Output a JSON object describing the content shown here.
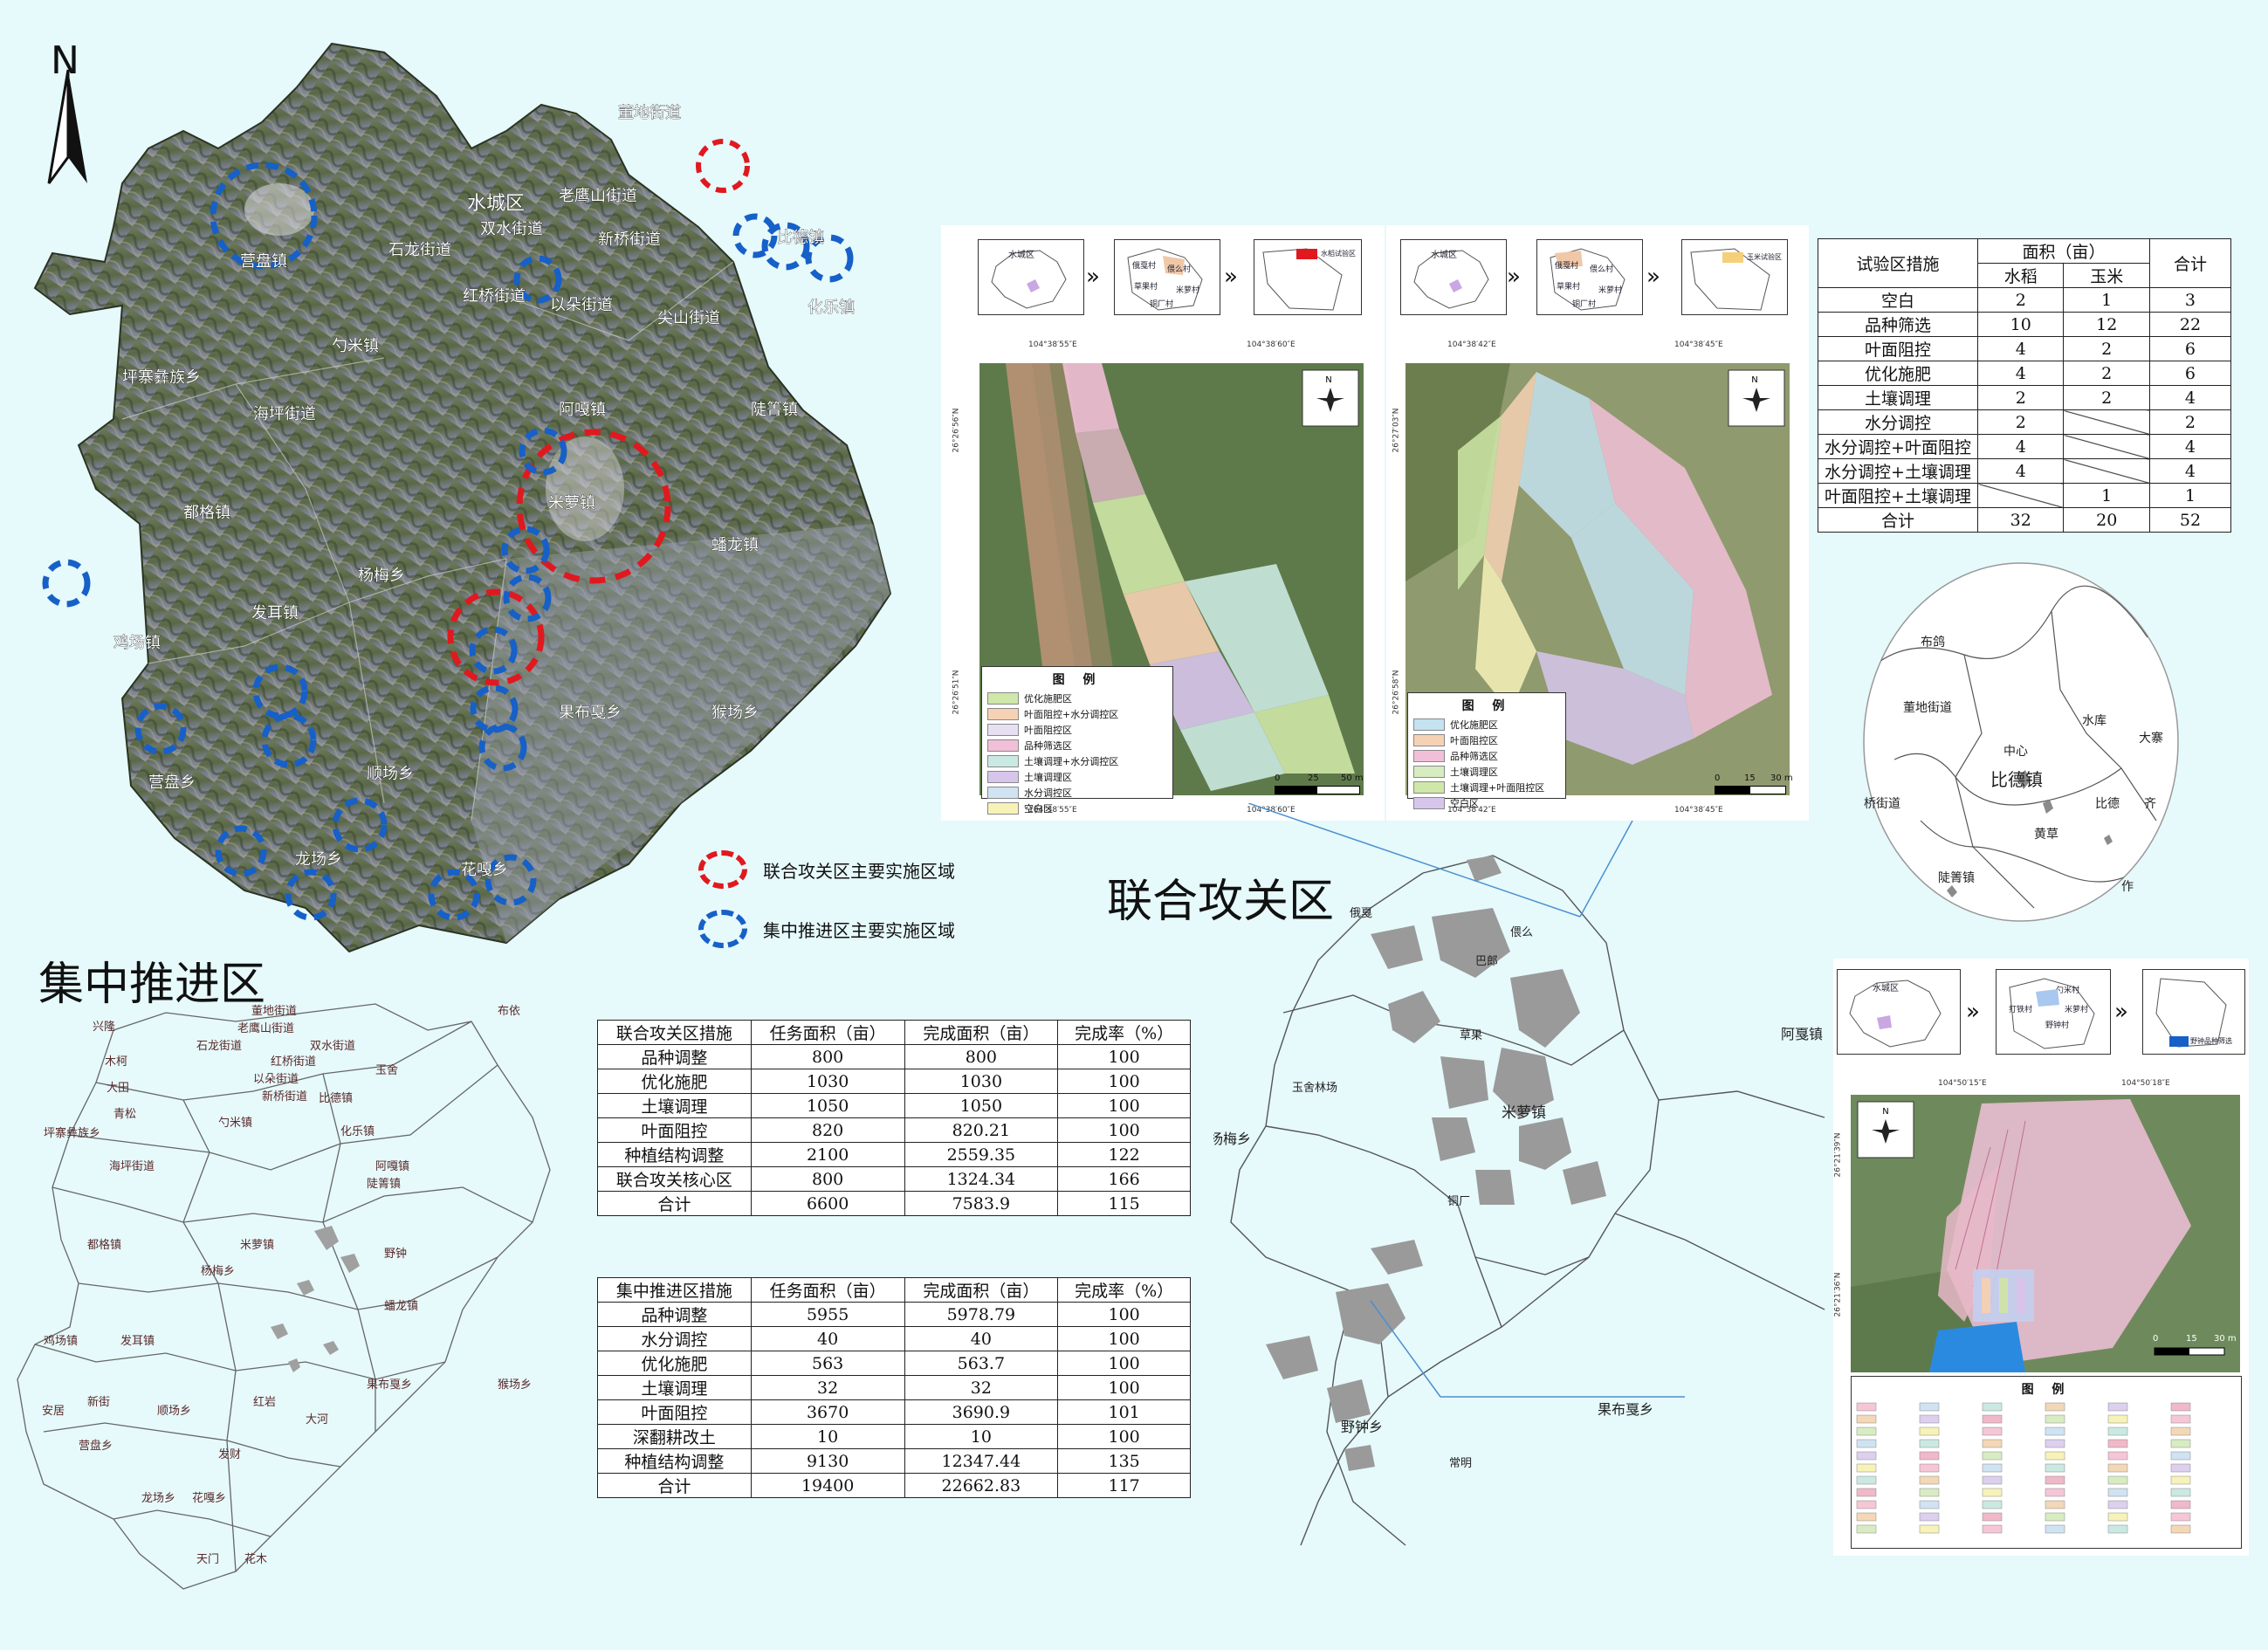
{
  "north": "N",
  "titles": {
    "joint": "联合攻关区",
    "central": "集中推进区"
  },
  "legend": {
    "joint_area": "联合攻关区主要实施区域",
    "central_area": "集中推进区主要实施区域",
    "joint_color": "#e0191f",
    "central_color": "#1660c8"
  },
  "satellite_labels": [
    "水城区",
    "董地街道",
    "老鹰山街道",
    "双水街道",
    "石龙街道",
    "红桥街道",
    "以朵街道",
    "新桥街道",
    "比德镇",
    "化乐镇",
    "营盘镇",
    "勺米镇",
    "尖山街道",
    "坪寨彝族乡",
    "海坪街道",
    "阿嘎镇",
    "陡箐镇",
    "米萝镇",
    "都格镇",
    "杨梅乡",
    "蟠龙镇",
    "发耳镇",
    "鸡场镇",
    "果布戛乡",
    "猴场乡",
    "营盘乡",
    "顺场乡",
    "龙场乡",
    "花嘎乡"
  ],
  "joint_table": {
    "headers": [
      "联合攻关区措施",
      "任务面积（亩）",
      "完成面积（亩）",
      "完成率（%）"
    ],
    "rows": [
      [
        "品种调整",
        "800",
        "800",
        "100"
      ],
      [
        "优化施肥",
        "1030",
        "1030",
        "100"
      ],
      [
        "土壤调理",
        "1050",
        "1050",
        "100"
      ],
      [
        "叶面阻控",
        "820",
        "820.21",
        "100"
      ],
      [
        "种植结构调整",
        "2100",
        "2559.35",
        "122"
      ],
      [
        "联合攻关核心区",
        "800",
        "1324.34",
        "166"
      ],
      [
        "合计",
        "6600",
        "7583.9",
        "115"
      ]
    ]
  },
  "central_table": {
    "headers": [
      "集中推进区措施",
      "任务面积（亩）",
      "完成面积（亩）",
      "完成率（%）"
    ],
    "rows": [
      [
        "品种调整",
        "5955",
        "5978.79",
        "100"
      ],
      [
        "水分调控",
        "40",
        "40",
        "100"
      ],
      [
        "优化施肥",
        "563",
        "563.7",
        "100"
      ],
      [
        "土壤调理",
        "32",
        "32",
        "100"
      ],
      [
        "叶面阻控",
        "3670",
        "3690.9",
        "101"
      ],
      [
        "深翻耕改土",
        "10",
        "10",
        "100"
      ],
      [
        "种植结构调整",
        "9130",
        "12347.44",
        "135"
      ],
      [
        "合计",
        "19400",
        "22662.83",
        "117"
      ]
    ]
  },
  "trial_table": {
    "h_measure": "试验区措施",
    "h_area": "面积（亩）",
    "h_rice": "水稻",
    "h_corn": "玉米",
    "h_total": "合计",
    "rows": [
      [
        "空白",
        "2",
        "1",
        "3"
      ],
      [
        "品种筛选",
        "10",
        "12",
        "22"
      ],
      [
        "叶面阻控",
        "4",
        "2",
        "6"
      ],
      [
        "优化施肥",
        "4",
        "2",
        "6"
      ],
      [
        "土壤调理",
        "2",
        "2",
        "4"
      ],
      [
        "水分调控",
        "2",
        "",
        "2"
      ],
      [
        "水分调控+叶面阻控",
        "4",
        "",
        "4"
      ],
      [
        "水分调控+土壤调理",
        "4",
        "",
        "4"
      ],
      [
        "叶面阻控+土壤调理",
        "",
        "1",
        "1"
      ],
      [
        "合计",
        "32",
        "20",
        "52"
      ]
    ]
  },
  "rice_legend": {
    "title": "图 例",
    "items": [
      {
        "label": "优化施肥区",
        "color": "#cfe7a8"
      },
      {
        "label": "叶面阻控+水分调控区",
        "color": "#f6d2b4"
      },
      {
        "label": "叶面阻控区",
        "color": "#e6e0f2"
      },
      {
        "label": "品种筛选区",
        "color": "#f1c0d8"
      },
      {
        "label": "土壤调理+水分调控区",
        "color": "#cbe9e3"
      },
      {
        "label": "土壤调理区",
        "color": "#d7c6ec"
      },
      {
        "label": "水分调控区",
        "color": "#cfe3f3"
      },
      {
        "label": "空白区",
        "color": "#f7f3b8"
      }
    ]
  },
  "corn_legend": {
    "title": "图 例",
    "items": [
      {
        "label": "优化施肥区",
        "color": "#c4e2f0"
      },
      {
        "label": "叶面阻控区",
        "color": "#f6d2b4"
      },
      {
        "label": "品种筛选区",
        "color": "#f1c0d8"
      },
      {
        "label": "土壤调理区",
        "color": "#d7ecc0"
      },
      {
        "label": "土壤调理+叶面阻控区",
        "color": "#cfe7a8"
      },
      {
        "label": "空白区",
        "color": "#d7c6ec"
      }
    ]
  },
  "rice_inset": {
    "l1": "水城区",
    "l2a": "俄戛村",
    "l2b": "偎么村",
    "l2c": "草果村",
    "l2d": "米萝村",
    "l2e": "铜厂村",
    "l3": "水稻试验区",
    "coord_top_a": "104°38′55″E",
    "coord_top_b": "104°38′60″E",
    "coord_bot_a": "104°38′55″E",
    "coord_bot_b": "104°38′60″E",
    "coord_lat_a": "26°26′56″N",
    "coord_lat_b": "26°26′51″N",
    "scale_a": "0",
    "scale_b": "25",
    "scale_c": "50 m"
  },
  "corn_inset": {
    "l1": "水城区",
    "l2a": "俄戛村",
    "l2b": "偎么村",
    "l2c": "草果村",
    "l2d": "米萝村",
    "l2e": "铜厂村",
    "l3": "玉米试验区",
    "coord_top_a": "104°38′42″E",
    "coord_top_b": "104°38′45″E",
    "coord_bot_a": "104°38′42″E",
    "coord_bot_b": "104°38′45″E",
    "coord_lat_a": "26°27′03″N",
    "coord_lat_b": "26°26′58″N",
    "scale_a": "0",
    "scale_b": "15",
    "scale_c": "30 m"
  },
  "variety_inset": {
    "l1": "水城区",
    "l2a": "勺米村",
    "l2b": "打铁村",
    "l2c": "米萝村",
    "l2d": "野钟村",
    "l3": "野钟品种筛选",
    "legend_title": "图 例",
    "coord_top_a": "104°50′15″E",
    "coord_top_b": "104°50′18″E",
    "coord_lat_a": "26°21′39″N",
    "coord_lat_b": "26°21′36″N",
    "scale_a": "0",
    "scale_b": "15",
    "scale_c": "30 m"
  },
  "circle_map_labels": [
    "布鸽",
    "董地街道",
    "中心",
    "比德镇",
    "水库",
    "大寨",
    "桥街道",
    "黄草",
    "陡箐镇",
    "比德",
    "齐",
    "作"
  ],
  "joint_map_labels": [
    "俄戛",
    "偎么",
    "巴郎",
    "草果",
    "玉舍林场",
    "米萝镇",
    "铜厂",
    "阿戛镇",
    "杨梅乡",
    "野钟乡",
    "常明",
    "果布戛乡"
  ],
  "central_map_labels": [
    "董地街道",
    "老鹰山街道",
    "双水街道",
    "石龙街道",
    "红桥街道",
    "以朵街道",
    "新桥街道",
    "比德镇",
    "化乐镇",
    "布依",
    "兴隆",
    "木柯",
    "大田",
    "青松",
    "勺米镇",
    "坪寨彝族乡",
    "海坪街道",
    "阿嘎镇",
    "陡箐镇",
    "米萝镇",
    "都格镇",
    "杨梅乡",
    "蟠龙镇",
    "发耳镇",
    "鸡场镇",
    "果布戛乡",
    "猴场乡",
    "营盘乡",
    "顺场乡",
    "龙场乡",
    "花嘎乡",
    "安居",
    "玉舍",
    "野钟",
    "红岩",
    "新街",
    "发财",
    "大河",
    "天门",
    "花木"
  ]
}
